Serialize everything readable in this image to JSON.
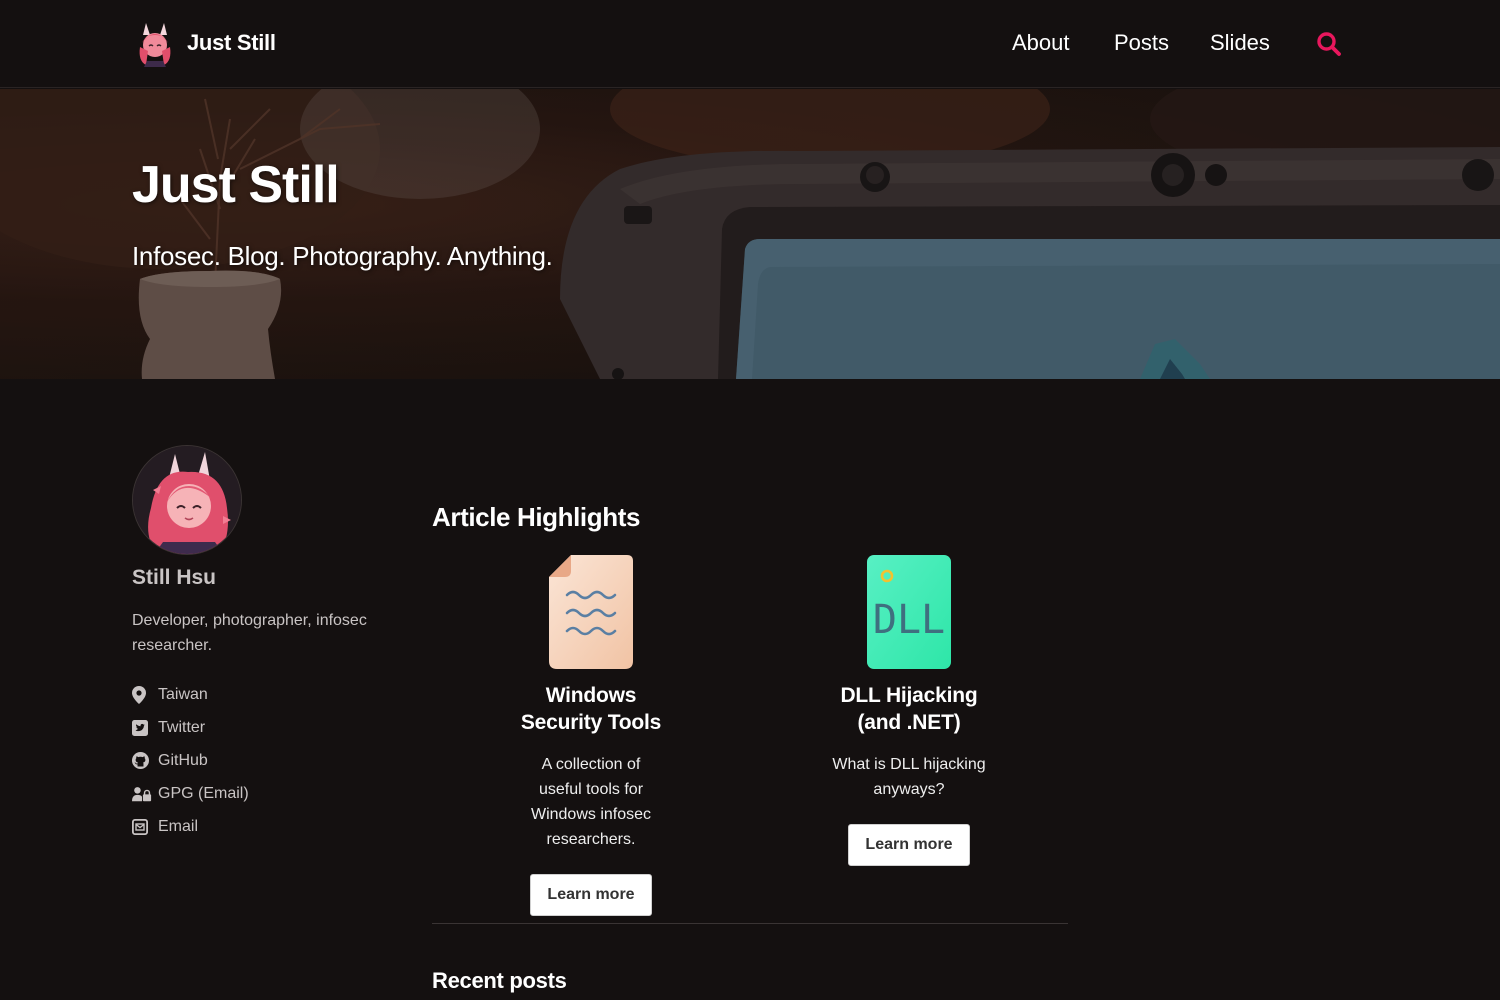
{
  "masthead": {
    "site_title": "Just Still",
    "nav": [
      {
        "label": "About"
      },
      {
        "label": "Posts"
      },
      {
        "label": "Slides"
      }
    ],
    "search_icon": "search-icon",
    "accent_color": "#e8175d"
  },
  "hero": {
    "title": "Just Still",
    "tagline": "Infosec. Blog. Photography. Anything."
  },
  "author": {
    "name": "Still Hsu",
    "bio": "Developer, photographer, infosec researcher.",
    "links": [
      {
        "label": "Taiwan",
        "icon": "map-marker-icon"
      },
      {
        "label": "Twitter",
        "icon": "twitter-square-icon"
      },
      {
        "label": "GitHub",
        "icon": "github-icon"
      },
      {
        "label": "GPG (Email)",
        "icon": "user-lock-icon"
      },
      {
        "label": "Email",
        "icon": "envelope-square-icon"
      }
    ]
  },
  "main": {
    "highlights_title": "Article Highlights",
    "features": [
      {
        "title": "Windows Security Tools",
        "excerpt": "A collection of useful tools for Windows infosec researchers.",
        "button": "Learn more",
        "thumb_icon": "document-icon"
      },
      {
        "title": "DLL Hijacking (and .NET)",
        "excerpt": "What is DLL hijacking anyways?",
        "button": "Learn more",
        "thumb_icon": "dll-file-icon",
        "thumb_text": "DLL"
      }
    ],
    "recent_title": "Recent posts"
  }
}
